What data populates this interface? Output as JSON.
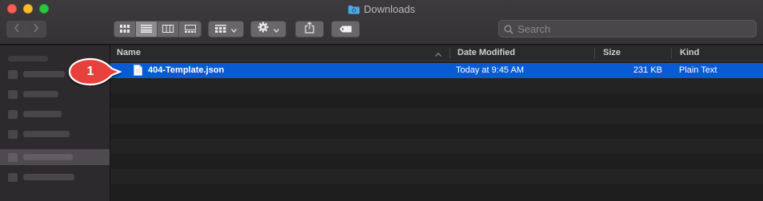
{
  "window": {
    "title": "Downloads"
  },
  "toolbar": {
    "nav_back": "back",
    "nav_forward": "forward",
    "search_placeholder": "Search"
  },
  "columns": {
    "name": "Name",
    "date_modified": "Date Modified",
    "size": "Size",
    "kind": "Kind"
  },
  "files": [
    {
      "name": "404-Template.json",
      "date_modified": "Today at 9:45 AM",
      "size": "231 KB",
      "kind": "Plain Text",
      "selected": true
    }
  ],
  "callout": {
    "number": "1",
    "color": "#e8413c"
  },
  "colors": {
    "selection": "#0a5bd3",
    "folder_icon": "#4aa8e8"
  }
}
